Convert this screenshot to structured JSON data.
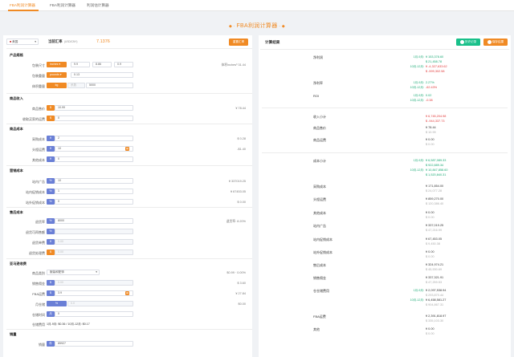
{
  "tabs": [
    "FBA利润计算器",
    "FBA利润计算器",
    "利润估计算器"
  ],
  "title": "FBA利润计算器",
  "top": {
    "country": "美国",
    "rate_label": "当前汇率",
    "rate_unit": "(USD/CNY)",
    "rate": "7.1376",
    "reset": "重置汇率"
  },
  "left": {
    "product": {
      "title": "产品规格",
      "size_label": "包装尺寸",
      "size_unit": "inches",
      "size_vals": [
        "9.9",
        "8.86",
        "0.9"
      ],
      "size_right": "体积inches³ 31.44",
      "weight_label": "包装重量",
      "weight_unit": "pounds",
      "weight_val": "0.13",
      "vol_label": "体积重量",
      "vol_unit": "kg",
      "vol_div": "系数",
      "vol_val": "5000"
    },
    "income": {
      "title": "商品收入",
      "price_label": "商品售价",
      "price_tag": "$",
      "price": "10.99",
      "price_right": "¥ 78.44",
      "ship_label": "收取买家的运费",
      "ship_tag": "$",
      "ship": "0"
    },
    "cost": {
      "title": "商品成本",
      "buy_label": "采购成本",
      "buy_tag": "¥",
      "buy": "2",
      "buy_right": "$ 0.28",
      "head_label": "头程运费",
      "head_tag": "¥",
      "head": "10",
      "head_right": "-$1.40",
      "other_label": "其他成本",
      "other_tag": "¥",
      "other": "0",
      "other_right": "$ 0.00"
    },
    "ops": {
      "title": "营销成本",
      "ad_label": "站内广告",
      "ad_tag": "%",
      "ad": "10",
      "ad_right": "¥ 337019.25",
      "promo_label": "站内促销成本",
      "promo_tag": "%",
      "promo": "1",
      "promo_right": "¥ 67453.05",
      "out_label": "站外促销成本",
      "out_tag": "%",
      "out": "0",
      "out_right": "$ 0.00"
    },
    "after": {
      "title": "售后成本",
      "ret_label": "退货率",
      "ret_tag": "%",
      "ret": "8000",
      "ret_right": "退货率: 8.20%",
      "r2_label": "退货可再售额",
      "r2_tag": "%",
      "r3_label": "退货单费",
      "r3_tag": "¥",
      "r3": "0.00",
      "r4_label": "退货处理费",
      "r4_tag": "$",
      "r4": "0.00"
    },
    "amazon": {
      "title": "亚马逊收费",
      "cat_label": "商品类别",
      "cat_val": "服装和配饰",
      "cat_right": "$0.99 · 0.00%",
      "ref_label": "销售佣金",
      "ref_tag": "$",
      "ref": "0.00",
      "ref_right": "$ 3.60",
      "fba_label": "FBA运费",
      "fba_tag": "$",
      "fba": "3.9",
      "fba_right": "¥ 27.84",
      "store_label": "月仓储",
      "store_tag": "¥",
      "store_unit": "%",
      "store_right": "$0.00",
      "time_label": "仓储时间",
      "time_tag": "月",
      "time": "0",
      "fee_label": "仓储费用",
      "fee_text": "1月-9月: $0.36 / 10月-12月: $0.17"
    },
    "sales": {
      "title": "销量",
      "qty_label": "销量",
      "qty_tag": "件",
      "qty": "85927"
    }
  },
  "right": {
    "title": "计算结果",
    "btn1": "历史记录",
    "btn2": "保存结果",
    "rows": [
      {
        "label": "净利润",
        "items": [
          {
            "p": "1月-9月:",
            "v": "¥ 153,378.60",
            "c": "g"
          },
          {
            "p": "",
            "v": "$ 21,458.78",
            "c": "g"
          },
          {
            "p": "10月-12月:",
            "v": "¥ -4,327,633.62",
            "c": "rd"
          },
          {
            "p": "",
            "v": "$ -599,302.58",
            "c": "rd"
          }
        ]
      },
      {
        "label": "净利率",
        "items": [
          {
            "p": "1月-9月:",
            "v": "2.27%",
            "c": "g"
          },
          {
            "p": "10月-12月:",
            "v": "-62.43%",
            "c": "rd"
          }
        ]
      },
      {
        "label": "ROI",
        "items": [
          {
            "p": "1月-9月:",
            "v": "0.02",
            "c": "g"
          },
          {
            "p": "10月-12月:",
            "v": "-0.38",
            "c": "rd"
          }
        ]
      },
      {
        "label": "收入小计",
        "items": [
          {
            "p": "",
            "v": "¥ 6,745,204.98",
            "c": "rd"
          },
          {
            "p": "",
            "v": "$ -944,337.73",
            "c": "rd"
          }
        ]
      },
      {
        "label": "商品售价",
        "items": [
          {
            "p": "",
            "v": "¥ 78.44",
            "c": "k"
          },
          {
            "p": "",
            "v": "$ 10.99",
            "c": "gr"
          }
        ]
      },
      {
        "label": "商品运费",
        "items": [
          {
            "p": "",
            "v": "¥ 0.00",
            "c": "k"
          },
          {
            "p": "",
            "v": "$ 0.00",
            "c": "gr"
          }
        ]
      },
      {
        "label": "成本小计",
        "items": [
          {
            "p": "1月-9月:",
            "v": "¥ 6,587,089.33",
            "c": "g"
          },
          {
            "p": "",
            "v": "$ 922,889.34",
            "c": "g"
          },
          {
            "p": "10月-12月:",
            "v": "¥ 10,847,858.60",
            "c": "g"
          },
          {
            "p": "",
            "v": "$ 1,520,840.31",
            "c": "g"
          }
        ]
      },
      {
        "label": "采购成本",
        "items": [
          {
            "p": "",
            "v": "¥ 171,854.00",
            "c": "k"
          },
          {
            "p": "",
            "v": "$ 24,077.28",
            "c": "gr"
          }
        ]
      },
      {
        "label": "头程运费",
        "items": [
          {
            "p": "",
            "v": "¥ 859,270.00",
            "c": "k"
          },
          {
            "p": "",
            "v": "$ 120,386.40",
            "c": "gr"
          }
        ]
      },
      {
        "label": "其他成本",
        "items": [
          {
            "p": "",
            "v": "¥ 0.00",
            "c": "k"
          },
          {
            "p": "",
            "v": "$ 0.00",
            "c": "gr"
          }
        ]
      },
      {
        "label": "站内广告",
        "items": [
          {
            "p": "",
            "v": "¥ 337,019.25",
            "c": "k"
          },
          {
            "p": "",
            "v": "$ 47,216.99",
            "c": "gr"
          }
        ]
      },
      {
        "label": "站内促销成本",
        "items": [
          {
            "p": "",
            "v": "¥ 67,453.05",
            "c": "k"
          },
          {
            "p": "",
            "v": "$ 9,450.38",
            "c": "gr"
          }
        ]
      },
      {
        "label": "站外促销成本",
        "items": [
          {
            "p": "",
            "v": "¥ 0.00",
            "c": "k"
          },
          {
            "p": "",
            "v": "$ 0.00",
            "c": "gr"
          }
        ]
      },
      {
        "label": "售后成本",
        "items": [
          {
            "p": "",
            "v": "¥ 324,974.21",
            "c": "k"
          },
          {
            "p": "",
            "v": "$ 45,530.69",
            "c": "gr"
          }
        ]
      },
      {
        "label": "销售佣金",
        "items": [
          {
            "p": "",
            "v": "¥ 337,321.91",
            "c": "k"
          },
          {
            "p": "",
            "v": "$ 47,259.53",
            "c": "gr"
          }
        ]
      },
      {
        "label": "仓仓储费用",
        "items": [
          {
            "p": "1月-9月:",
            "v": "¥ 2,097,538.94",
            "c": "k"
          },
          {
            "p": "",
            "v": "$ 293,870.44",
            "c": "gr"
          },
          {
            "p": "10月-12月:",
            "v": "¥ 6,458,581.27",
            "c": "k"
          },
          {
            "p": "",
            "v": "$ 904,867.31",
            "c": "gr"
          }
        ]
      },
      {
        "label": "FBA运费",
        "items": [
          {
            "p": "",
            "v": "¥ 2,391,818.97",
            "c": "k"
          },
          {
            "p": "",
            "v": "$ 335,103.30",
            "c": "gr"
          }
        ]
      },
      {
        "label": "其他",
        "items": [
          {
            "p": "",
            "v": "¥ 0.00",
            "c": "k"
          },
          {
            "p": "",
            "v": "$ 0.00",
            "c": "gr"
          }
        ]
      }
    ]
  }
}
